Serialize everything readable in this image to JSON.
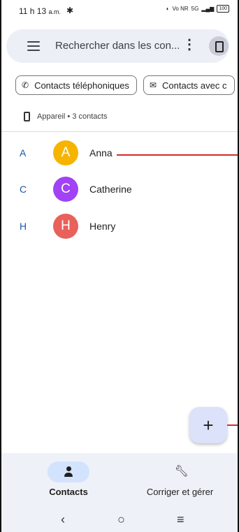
{
  "status": {
    "time": "11 h 13",
    "ampm": "a.m.",
    "settings_icon": "gear-icon",
    "network": "Vo NR",
    "signal": "5G",
    "battery": "100"
  },
  "search": {
    "placeholder": "Rechercher dans les con..."
  },
  "chips": [
    {
      "label": "Contacts téléphoniques",
      "icon": "phone-icon"
    },
    {
      "label": "Contacts avec c",
      "icon": "mail-icon"
    }
  ],
  "account": {
    "label": "Appareil • 3 contacts"
  },
  "contacts": [
    {
      "letter": "A",
      "initial": "A",
      "name": "Anna",
      "color": "#f6b400"
    },
    {
      "letter": "C",
      "initial": "C",
      "name": "Catherine",
      "color": "#a142f4"
    },
    {
      "letter": "H",
      "initial": "H",
      "name": "Henry",
      "color": "#e8615a"
    }
  ],
  "fab": {
    "symbol": "+"
  },
  "bottom_nav": {
    "contacts_label": "Contacts",
    "manage_label": "Corriger et gérer"
  },
  "system_nav": {
    "back": "‹",
    "home": "○",
    "recents": "≡"
  }
}
